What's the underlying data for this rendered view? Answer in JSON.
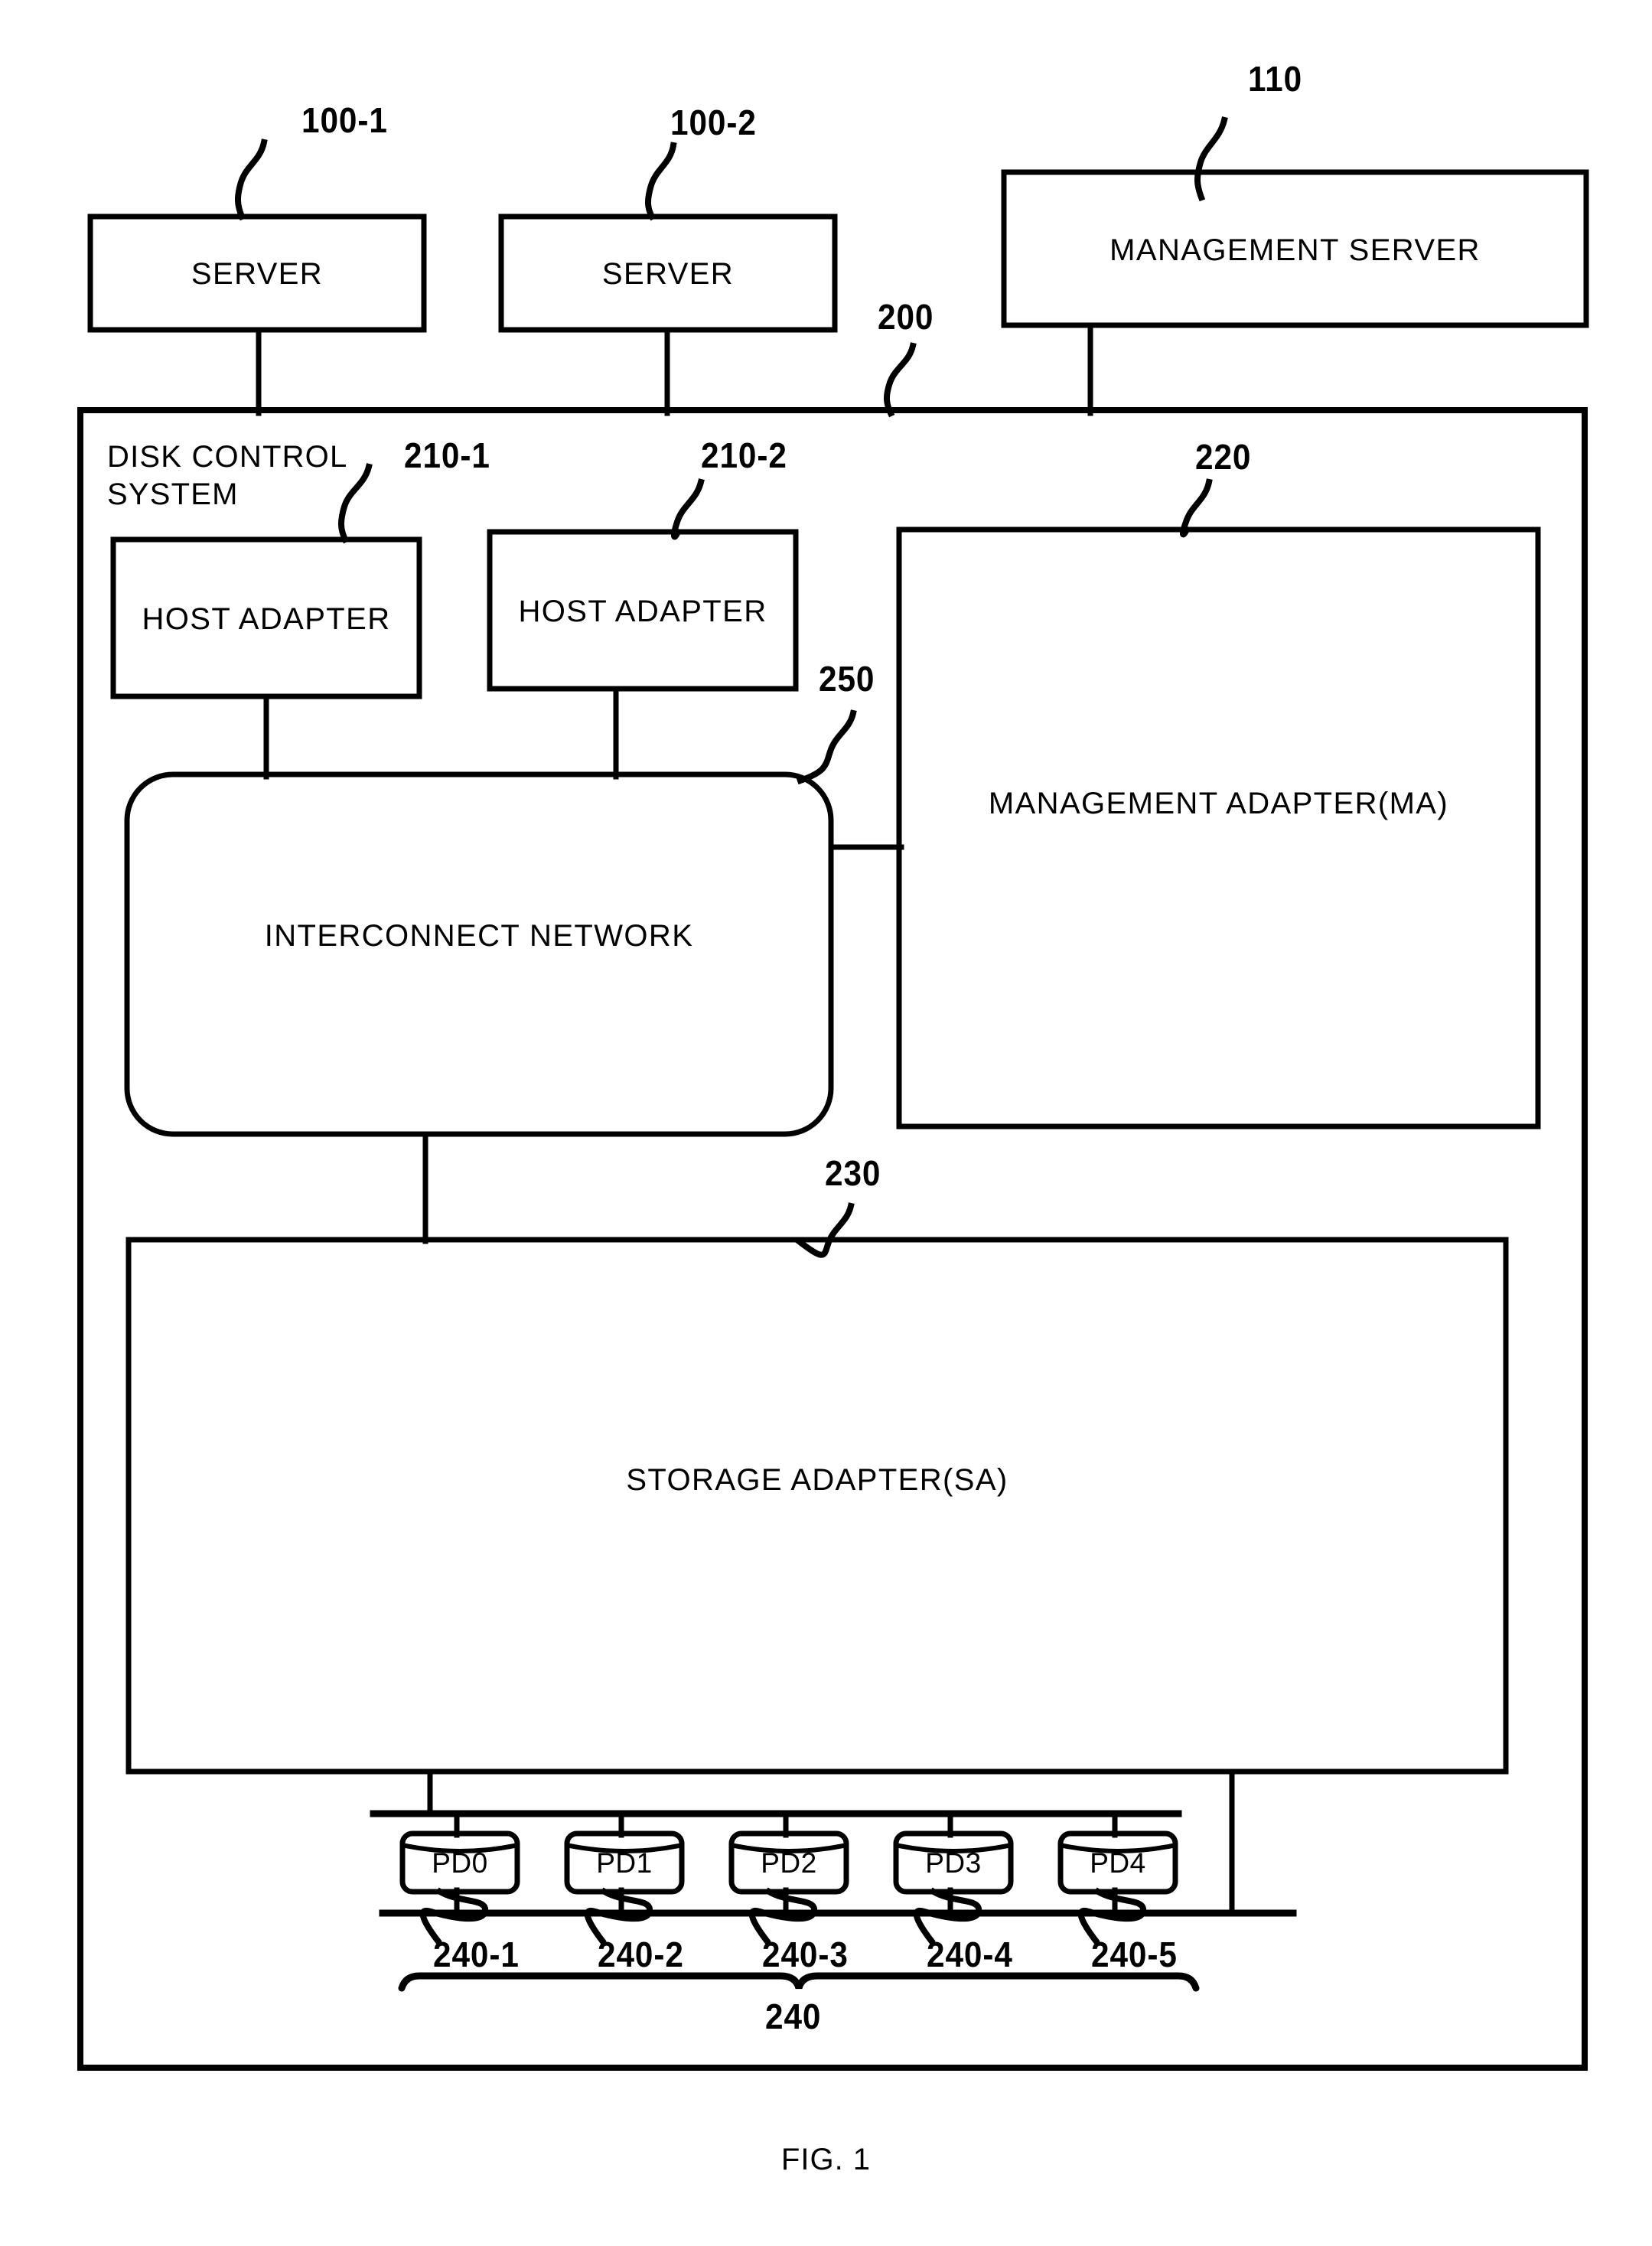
{
  "figure": {
    "caption": "FIG. 1",
    "title_block": "DISK CONTROL SYSTEM"
  },
  "nodes": {
    "server_1": {
      "label": "SERVER",
      "ref": "100-1"
    },
    "server_2": {
      "label": "SERVER",
      "ref": "100-2"
    },
    "management_server": {
      "label": "MANAGEMENT SERVER",
      "ref": "110"
    },
    "disk_control_system": {
      "label_line1": "DISK CONTROL",
      "label_line2": "SYSTEM",
      "ref": "200"
    },
    "host_adapter_1": {
      "label": "HOST ADAPTER",
      "ref": "210-1"
    },
    "host_adapter_2": {
      "label": "HOST ADAPTER",
      "ref": "210-2"
    },
    "interconnect_network": {
      "label": "INTERCONNECT NETWORK",
      "ref": "250"
    },
    "management_adapter": {
      "label": "MANAGEMENT ADAPTER(MA)",
      "ref": "220"
    },
    "storage_adapter": {
      "label": "STORAGE ADAPTER(SA)",
      "ref": "230"
    }
  },
  "physical_disks": {
    "group_ref": "240",
    "items": [
      {
        "label": "PD0",
        "ref": "240-1"
      },
      {
        "label": "PD1",
        "ref": "240-2"
      },
      {
        "label": "PD2",
        "ref": "240-3"
      },
      {
        "label": "PD3",
        "ref": "240-4"
      },
      {
        "label": "PD4",
        "ref": "240-5"
      }
    ]
  },
  "colors": {
    "ink": "#000000",
    "paper": "#ffffff"
  }
}
